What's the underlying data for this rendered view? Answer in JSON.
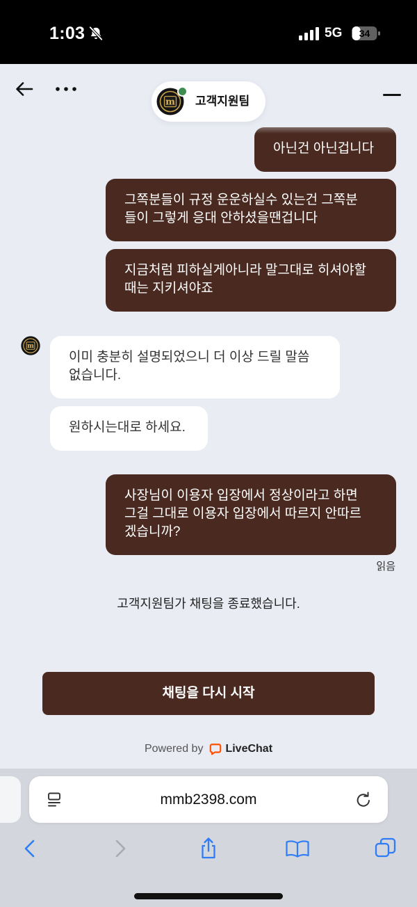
{
  "status_bar": {
    "time": "1:03",
    "network": "5G",
    "battery": "34",
    "icons": [
      "bell-slash-icon",
      "signal-bars-icon",
      "battery-icon"
    ]
  },
  "header": {
    "agent_name": "고객지원팀",
    "logo_mark": "m",
    "online": true,
    "icons": {
      "back": "arrow-left-icon",
      "more": "more-dots-icon",
      "minimize": "minimize-icon"
    }
  },
  "messages": [
    {
      "outgoing": true,
      "lines": [
        "아닌건 아닌겁니다"
      ]
    },
    {
      "outgoing": true,
      "lines": [
        "그쪽분들이 규정 운운하실수 있는건 그쪽분",
        "들이 그렇게 응대 안하셨을땐겁니다"
      ]
    },
    {
      "outgoing": true,
      "lines": [
        "지금처럼 피하실게아니라 말그대로 히셔야할",
        "때는 지키셔야죠"
      ]
    },
    {
      "outgoing": false,
      "lines": [
        "이미 충분히 설명되었으니 더 이상 드릴 말씀",
        "없습니다."
      ]
    },
    {
      "outgoing": false,
      "lines": [
        "원하시는대로 하세요."
      ]
    },
    {
      "outgoing": true,
      "lines": [
        "사장님이 이용자 입장에서 정상이라고 하면",
        "그걸 그대로 이용자 입장에서 따르지 안따르",
        "겠습니까?"
      ]
    }
  ],
  "read_receipt": "읽음",
  "system_message": "고객지원팀가 채팅을 종료했습니다.",
  "restart_button": {
    "label": "채팅을 다시 시작"
  },
  "powered_by": {
    "prefix": "Powered by",
    "brand": "LiveChat",
    "icon": "livechat-logo-icon"
  },
  "browser": {
    "url": "mmb2398.com",
    "back_enabled": true,
    "forward_enabled": false,
    "icons": {
      "page_menu": "page-menu-icon",
      "reload": "reload-icon",
      "back": "chevron-left-icon",
      "forward": "chevron-right-icon",
      "share": "share-icon",
      "bookmarks": "book-icon",
      "tabs": "tabs-icon"
    }
  },
  "colors": {
    "chat_background": "#e9ecf3",
    "outgoing_bubble": "#4a2a20",
    "incoming_bubble": "#ffffff",
    "online_indicator": "#3f8d50",
    "toolbar_blue": "#2f7cf6",
    "toolbar_disabled": "#a7abb2",
    "livechat_orange": "#ff5100",
    "browser_background": "#d3d6dd"
  }
}
